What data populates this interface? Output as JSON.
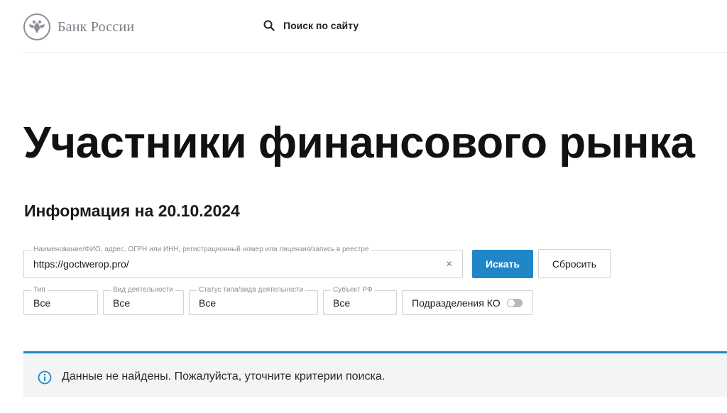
{
  "header": {
    "logo_text": "Банк России",
    "search_label": "Поиск по сайту"
  },
  "page": {
    "title": "Участники финансового рынка",
    "subtitle": "Информация на 20.10.2024"
  },
  "search": {
    "label": "Наименование/ФИО, адрес, ОГРН или ИНН, регистрационный номер или лицензия/запись в реестре",
    "value": "https://goctwerop.pro/",
    "clear_glyph": "×",
    "submit_label": "Искать",
    "reset_label": "Сбросить"
  },
  "filters": {
    "type": {
      "label": "Тип",
      "value": "Все"
    },
    "activity": {
      "label": "Вид деятельности",
      "value": "Все"
    },
    "status": {
      "label": "Статус типа/вида деятельности",
      "value": "Все"
    },
    "region": {
      "label": "Субъект РФ",
      "value": "Все"
    },
    "subdivisions": {
      "label": "Подразделения КО",
      "enabled": false
    }
  },
  "notice": {
    "message": "Данные не найдены. Пожалуйста, уточните критерии поиска."
  },
  "colors": {
    "accent": "#1f86c8",
    "logo_gray": "#7b8089",
    "notice_bg": "#f3f4f5"
  },
  "icons": {
    "logo": "double-headed-eagle-emblem",
    "search": "magnifier-icon",
    "info": "info-circle-icon"
  }
}
